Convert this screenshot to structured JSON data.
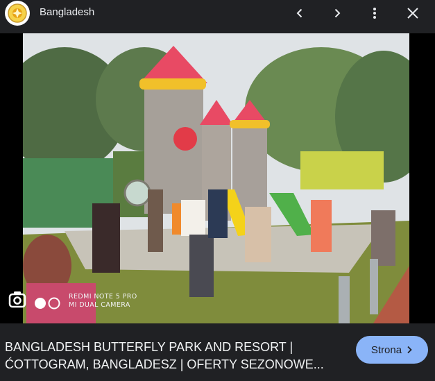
{
  "header": {
    "title": "Bangladesh",
    "icons": {
      "logo": "site-logo",
      "prev": "chevron-left-icon",
      "next": "chevron-right-icon",
      "more": "more-vert-icon",
      "close": "close-icon"
    }
  },
  "image": {
    "description_icons": [
      "camera-icon",
      "record-dot-icon",
      "ring-icon"
    ],
    "watermark_line1": "REDMI NOTE 5 PRO",
    "watermark_line2": "MI DUAL CAMERA"
  },
  "footer": {
    "caption_line1": "BANGLADESH BUTTERFLY PARK AND RESORT |",
    "caption_line2": "ĆOTTOGRAM, BANGLADESZ | OFERTY SEZONOWE...",
    "visit_label": "Strona",
    "visit_icon": "chevron-right-icon"
  },
  "colors": {
    "background": "#202124",
    "text": "#e8eaed",
    "button": "#8ab4f8"
  }
}
